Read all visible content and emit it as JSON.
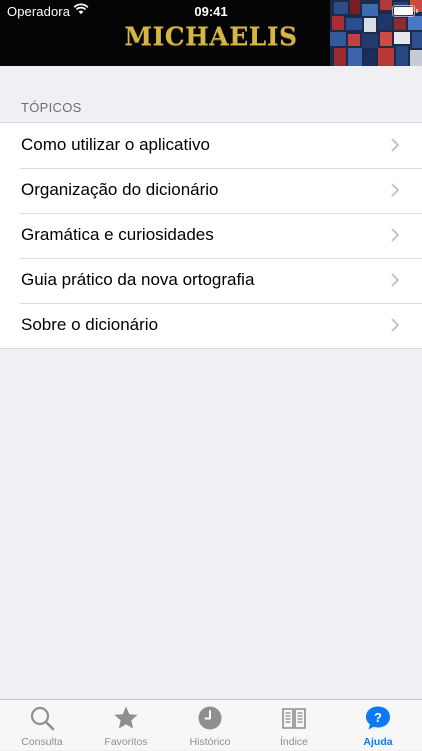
{
  "status_bar": {
    "carrier": "Operadora",
    "time": "09:41"
  },
  "header": {
    "logo": "MICHAELIS"
  },
  "topics": {
    "section_title": "TÓPICOS",
    "items": [
      {
        "label": "Como utilizar o aplicativo"
      },
      {
        "label": "Organização do dicionário"
      },
      {
        "label": "Gramática e curiosidades"
      },
      {
        "label": "Guia prático da nova ortografia"
      },
      {
        "label": "Sobre o dicionário"
      }
    ]
  },
  "tabbar": {
    "tabs": [
      {
        "label": "Consulta",
        "icon": "search-icon"
      },
      {
        "label": "Favoritos",
        "icon": "star-icon"
      },
      {
        "label": "Histórico",
        "icon": "clock-icon"
      },
      {
        "label": "Índice",
        "icon": "book-icon"
      },
      {
        "label": "Ajuda",
        "icon": "help-icon",
        "active": true
      }
    ]
  },
  "colors": {
    "accent": "#0a7af5",
    "logo_gold": "#d4b545",
    "header_bg": "#050505",
    "inactive_tab": "#8e8e93"
  }
}
